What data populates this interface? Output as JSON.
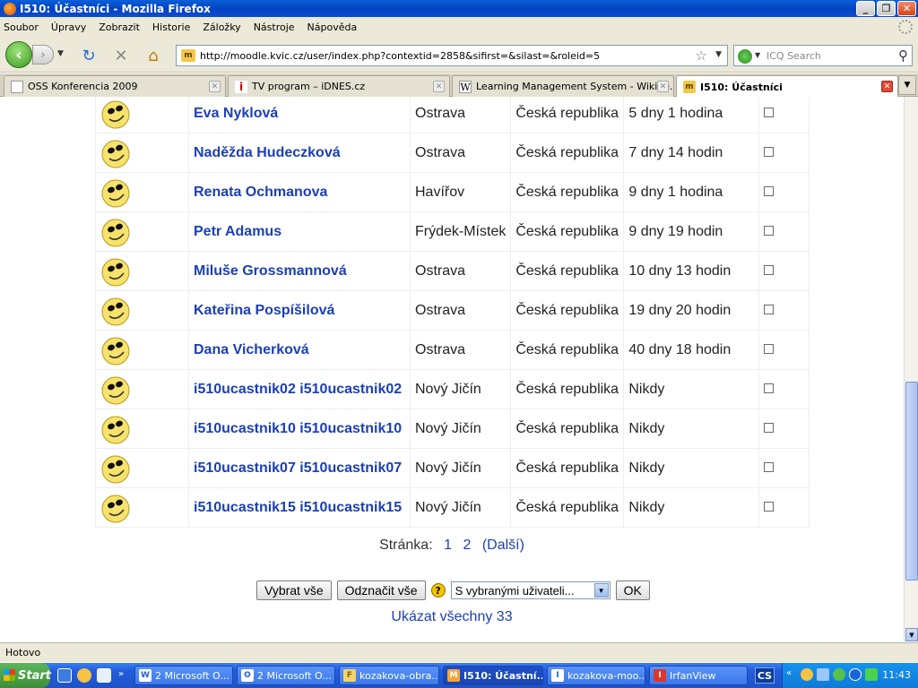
{
  "window": {
    "title": "I510: Účastníci - Mozilla Firefox"
  },
  "menu": [
    "Soubor",
    "Úpravy",
    "Zobrazit",
    "Historie",
    "Záložky",
    "Nástroje",
    "Nápověda"
  ],
  "nav": {
    "url": "http://moodle.kvic.cz/user/index.php?contextid=2858&sifirst=&silast=&roleid=5",
    "search_placeholder": "ICQ Search"
  },
  "tabs": [
    {
      "label": "OSS Konferencia 2009",
      "icon": "page-icon",
      "active": false
    },
    {
      "label": "TV program – iDNES.cz",
      "icon": "idnes-icon",
      "active": false
    },
    {
      "label": "Learning Management System - Wikipe...",
      "icon": "wikipedia-icon",
      "active": false
    },
    {
      "label": "I510: Účastníci",
      "icon": "moodle-icon",
      "active": true
    }
  ],
  "participants": [
    {
      "name": "Eva Nyklová",
      "city": "Ostrava",
      "country": "Česká republika",
      "last_access": "5 dny 1 hodina"
    },
    {
      "name": "Naděžda Hudeczková",
      "city": "Ostrava",
      "country": "Česká republika",
      "last_access": "7 dny 14 hodin"
    },
    {
      "name": "Renata Ochmanova",
      "city": "Havířov",
      "country": "Česká republika",
      "last_access": "9 dny 1 hodina"
    },
    {
      "name": "Petr Adamus",
      "city": "Frýdek-Místek",
      "country": "Česká republika",
      "last_access": "9 dny 19 hodin"
    },
    {
      "name": "Miluše Grossmannová",
      "city": "Ostrava",
      "country": "Česká republika",
      "last_access": "10 dny 13 hodin"
    },
    {
      "name": "Kateřina Pospíšilová",
      "city": "Ostrava",
      "country": "Česká republika",
      "last_access": "19 dny 20 hodin"
    },
    {
      "name": "Dana Vicherková",
      "city": "Ostrava",
      "country": "Česká republika",
      "last_access": "40 dny 18 hodin"
    },
    {
      "name": "i510ucastnik02 i510ucastnik02",
      "city": "Nový Jičín",
      "country": "Česká republika",
      "last_access": "Nikdy"
    },
    {
      "name": "i510ucastnik10 i510ucastnik10",
      "city": "Nový Jičín",
      "country": "Česká republika",
      "last_access": "Nikdy"
    },
    {
      "name": "i510ucastnik07 i510ucastnik07",
      "city": "Nový Jičín",
      "country": "Česká republika",
      "last_access": "Nikdy"
    },
    {
      "name": "i510ucastnik15 i510ucastnik15",
      "city": "Nový Jičín",
      "country": "Česká republika",
      "last_access": "Nikdy"
    }
  ],
  "paging": {
    "label": "Stránka:",
    "pages": [
      "1",
      "2"
    ],
    "next": "(Další)"
  },
  "controls": {
    "select_all": "Vybrat vše",
    "deselect_all": "Odznačit vše",
    "action_select": "S vybranými uživateli...",
    "ok": "OK",
    "show_all": "Ukázat všechny 33"
  },
  "status": "Hotovo",
  "taskbar": {
    "start": "Start",
    "tasks": [
      {
        "label": "2 Microsoft O...",
        "icon": "W"
      },
      {
        "label": "2 Microsoft O...",
        "icon": "O"
      },
      {
        "label": "kozakova-obra...",
        "icon": "F"
      },
      {
        "label": "I510: Účastní...",
        "icon": "M",
        "active": true
      },
      {
        "label": "kozakova-moo...",
        "icon": "I"
      },
      {
        "label": "IrfanView",
        "icon": "I"
      }
    ],
    "lang": "CS",
    "clock": "11:43"
  },
  "colors": {
    "link": "#1b3fb8",
    "titlebar": "#0343c2",
    "chrome": "#ece9d8"
  }
}
